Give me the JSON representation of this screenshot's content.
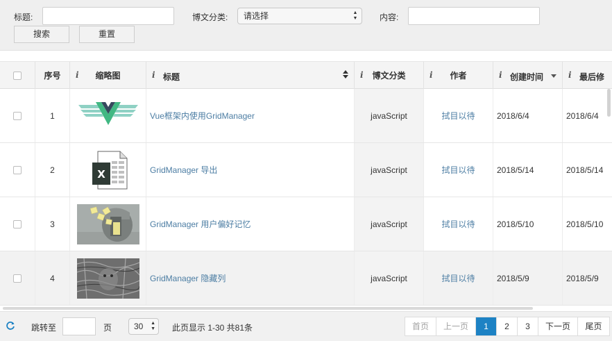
{
  "search": {
    "title_label": "标题:",
    "title_value": "",
    "category_label": "博文分类:",
    "category_selected": "请选择",
    "content_label": "内容:",
    "content_value": "",
    "search_button": "搜索",
    "reset_button": "重置"
  },
  "table": {
    "headers": {
      "index": "序号",
      "thumbnail": "缩略图",
      "title": "标题",
      "category": "博文分类",
      "author": "作者",
      "created": "创建时间",
      "modified": "最后修"
    },
    "info_glyph": "i",
    "rows": [
      {
        "index": "1",
        "title": "Vue框架内使用GridManager",
        "category": "javaScript",
        "author": "拭目以待",
        "created": "2018/6/4",
        "modified": "2018/6/4",
        "thumb": "vue-logo"
      },
      {
        "index": "2",
        "title": "GridManager 导出",
        "category": "javaScript",
        "author": "拭目以待",
        "created": "2018/5/14",
        "modified": "2018/5/14",
        "thumb": "excel-file-icon"
      },
      {
        "index": "3",
        "title": "GridManager 用户偏好记忆",
        "category": "javaScript",
        "author": "拭目以待",
        "created": "2018/5/10",
        "modified": "2018/5/10",
        "thumb": "head-memory-image"
      },
      {
        "index": "4",
        "title": "GridManager 隐藏列",
        "category": "javaScript",
        "author": "拭目以待",
        "created": "2018/5/9",
        "modified": "2018/5/9",
        "thumb": "owl-camouflage-image"
      }
    ]
  },
  "footer": {
    "goto_label": "跳转至",
    "goto_value": "",
    "page_unit": "页",
    "page_size": "30",
    "page_info": "此页显示 1-30 共81条",
    "pager": {
      "first": "首页",
      "prev": "上一页",
      "pages": [
        "1",
        "2",
        "3"
      ],
      "current": "1",
      "next": "下一页",
      "last": "尾页"
    }
  },
  "colors": {
    "link": "#4c7da3",
    "active_page": "#1d82c4",
    "vue_green": "#41b883",
    "vue_dark": "#35495e"
  }
}
